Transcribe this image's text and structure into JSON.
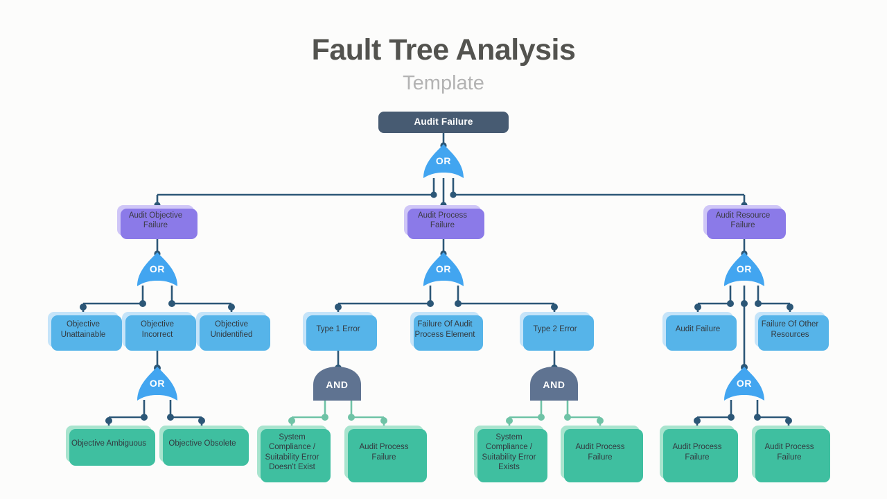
{
  "header": {
    "title": "Fault Tree Analysis",
    "subtitle": "Template"
  },
  "colors": {
    "root_fill": "#475b72",
    "level2_fill": "#cfc6f7",
    "level2_shadow": "#8b7ae8",
    "level3_fill": "#c5e4f9",
    "level3_shadow": "#56b4e9",
    "leaf_fill": "#a8e4ce",
    "leaf_shadow": "#3fbfa0",
    "or_gate": "#42a5f0",
    "and_gate": "#5f7391",
    "connector_dark": "#2c5777",
    "connector_green": "#6fc3a6",
    "title_text": "#53534f",
    "subtitle_text": "#b3b3b3"
  },
  "gates": {
    "or_label": "OR",
    "and_label": "AND",
    "g_root": "OR",
    "g_obj": "OR",
    "g_proc": "OR",
    "g_res": "OR",
    "g_obj_incorrect": "OR",
    "g_type1": "AND",
    "g_type2": "AND",
    "g_res_audit_failure": "OR"
  },
  "nodes": {
    "root": "Audit Failure",
    "l2_objective": "Audit Objective Failure",
    "l2_process": "Audit Process Failure",
    "l2_resource": "Audit Resource Failure",
    "l3_obj_unattainable": "Objective Unattainable",
    "l3_obj_incorrect": "Objective Incorrect",
    "l3_obj_unidentified": "Objective Unidentified",
    "l3_type1": "Type 1 Error",
    "l3_failure_element": "Failure Of Audit Process Element",
    "l3_type2": "Type 2 Error",
    "l3_audit_failure": "Audit Failure",
    "l3_other_resources": "Failure Of Other Resources",
    "l4_obj_ambiguous": "Objective Ambiguous",
    "l4_obj_obsolete": "Objective Obsolete",
    "l4_sys_not_exist": "System Compliance / Suitability Error Doesn't Exist",
    "l4_apf_1": "Audit Process Failure",
    "l4_sys_exists": "System Compliance / Suitability Error Exists",
    "l4_apf_2": "Audit Process Failure",
    "l4_apf_3": "Audit Process Failure",
    "l4_apf_4": "Audit Process Failure"
  }
}
